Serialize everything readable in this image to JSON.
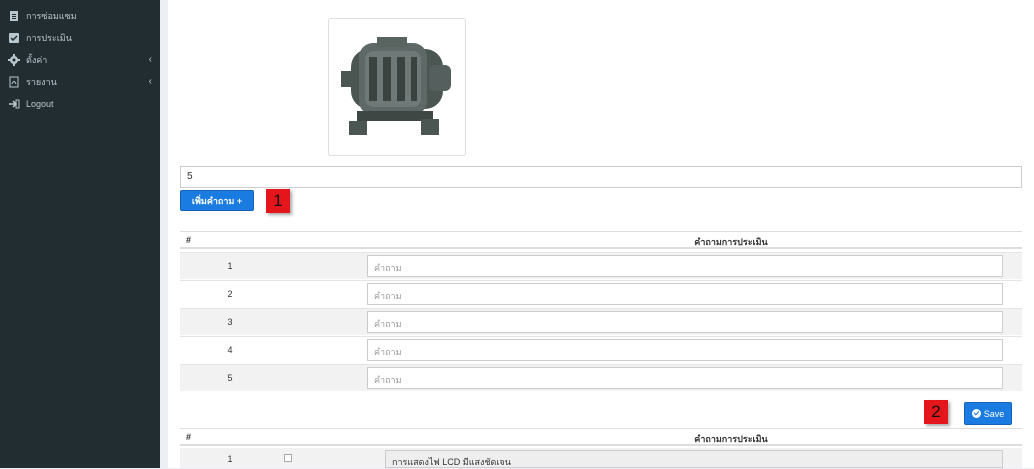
{
  "sidebar": {
    "items": [
      {
        "label": "การซ่อมแซม",
        "icon": "document-icon",
        "has_chevron": false
      },
      {
        "label": "การประเมิน",
        "icon": "checkbox-icon",
        "has_chevron": false
      },
      {
        "label": "ตั้งค่า",
        "icon": "gear-icon",
        "has_chevron": true,
        "chevron": "‹"
      },
      {
        "label": "รายงาน",
        "icon": "pdf-icon",
        "has_chevron": true,
        "chevron": "‹"
      },
      {
        "label": "Logout",
        "icon": "sign-out-icon",
        "has_chevron": false
      }
    ]
  },
  "main": {
    "question_count_value": "5",
    "add_question_label": "เพิ่มคำถาม +",
    "annotation_1": "1",
    "annotation_2": "2",
    "table1": {
      "col_num": "#",
      "col_title": "คำถามการประเมิน",
      "placeholder": "คำถาม",
      "rows": [
        {
          "num": "1"
        },
        {
          "num": "2"
        },
        {
          "num": "3"
        },
        {
          "num": "4"
        },
        {
          "num": "5"
        }
      ]
    },
    "save_label": "Save",
    "table2": {
      "col_num": "#",
      "col_title": "คำถามการประเมิน",
      "rows": [
        {
          "num": "1",
          "text": "การแสดงไฟ LCD มีแสงชัดเจน"
        }
      ]
    }
  },
  "colors": {
    "sidebar_bg": "#222d32",
    "accent": "#1a7be0",
    "annotation": "#e4161b"
  }
}
